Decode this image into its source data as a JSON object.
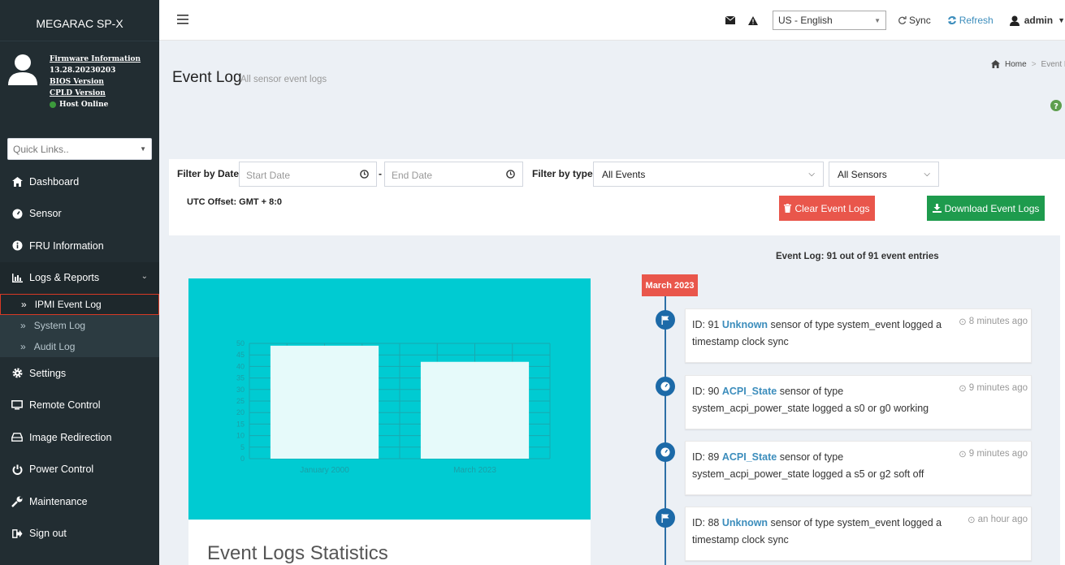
{
  "sidebar": {
    "app_title": "MEGARAC SP-X",
    "firmware_info_label": "Firmware Information",
    "firmware_version": "13.28.20230203",
    "bios_label": "BIOS Version",
    "cpld_label": "CPLD Version",
    "host_status": "Host Online",
    "quick_links_placeholder": "Quick Links..",
    "nav": [
      {
        "label": "Dashboard",
        "icon": "tachometer-icon"
      },
      {
        "label": "Sensor",
        "icon": "gauge-icon"
      },
      {
        "label": "FRU Information",
        "icon": "info-circle-icon"
      },
      {
        "label": "Logs & Reports",
        "icon": "bar-chart-icon"
      },
      {
        "label": "Settings",
        "icon": "gear-icon"
      },
      {
        "label": "Remote Control",
        "icon": "monitor-icon"
      },
      {
        "label": "Image Redirection",
        "icon": "drive-icon"
      },
      {
        "label": "Power Control",
        "icon": "power-icon"
      },
      {
        "label": "Maintenance",
        "icon": "wrench-icon"
      },
      {
        "label": "Sign out",
        "icon": "sign-out-icon"
      }
    ],
    "logs_sub": [
      {
        "label": "IPMI Event Log",
        "active": true
      },
      {
        "label": "System Log",
        "active": false
      },
      {
        "label": "Audit Log",
        "active": false
      }
    ]
  },
  "header": {
    "language": "US - English",
    "sync_label": "Sync",
    "refresh_label": "Refresh",
    "user": "admin"
  },
  "page": {
    "title": "Event Log",
    "subtitle": "All sensor event logs",
    "breadcrumb_home": "Home",
    "breadcrumb_current": "Event Log"
  },
  "filters": {
    "date_label": "Filter by Date",
    "start_placeholder": "Start Date",
    "dash": "-",
    "end_placeholder": "End Date",
    "type_label": "Filter by type",
    "type_value": "All Events",
    "sensor_value": "All Sensors",
    "utc_offset": "UTC Offset: GMT + 8:0",
    "clear_label": "Clear Event Logs",
    "download_label": "Download Event Logs"
  },
  "chart_data": {
    "type": "bar",
    "categories": [
      "January 2000",
      "March 2023"
    ],
    "values": [
      49,
      42
    ],
    "ylim": [
      0,
      50
    ],
    "yticks": [
      0,
      5,
      10,
      15,
      20,
      25,
      30,
      35,
      40,
      45,
      50
    ],
    "grid": true,
    "colors": {
      "background": "#00cbd2",
      "bar": "#e6fafa"
    }
  },
  "stats": {
    "title": "Event Logs Statistics"
  },
  "timeline": {
    "count_text": "Event Log: 91 out of 91 event entries",
    "month": "March 2023",
    "entries": [
      {
        "prefix": "ID: 91 ",
        "sensor": "Unknown",
        "text": " sensor of type system_event logged a timestamp clock sync",
        "time": "8 minutes ago",
        "icon": "flag-icon"
      },
      {
        "prefix": "ID: 90 ",
        "sensor": "ACPI_State",
        "text": " sensor of type system_acpi_power_state logged a s0 or g0 working",
        "time": "9 minutes ago",
        "icon": "gauge-icon"
      },
      {
        "prefix": "ID: 89 ",
        "sensor": "ACPI_State",
        "text": " sensor of type system_acpi_power_state logged a s5 or g2 soft off",
        "time": "9 minutes ago",
        "icon": "gauge-icon"
      },
      {
        "prefix": "ID: 88 ",
        "sensor": "Unknown",
        "text": " sensor of type system_event logged a timestamp clock sync",
        "time": "an hour ago",
        "icon": "flag-icon"
      }
    ]
  }
}
